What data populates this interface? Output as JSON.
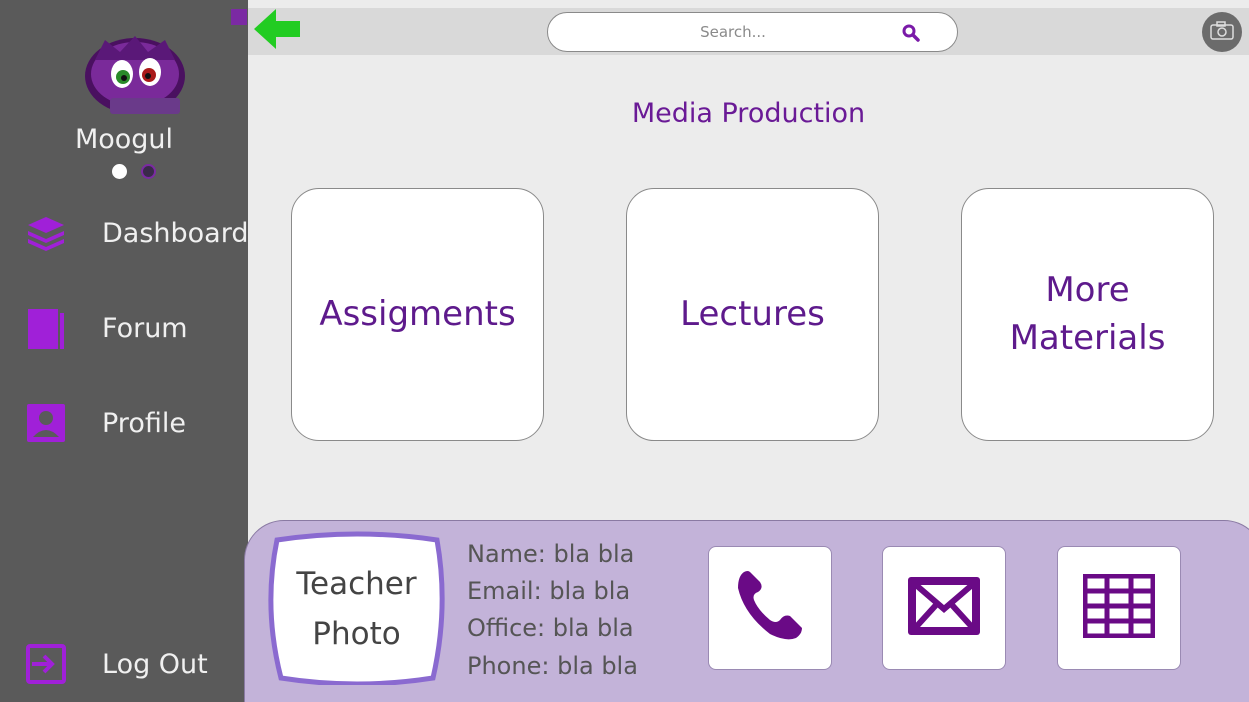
{
  "user": {
    "name": "Moogul"
  },
  "carousel": {
    "dots": 2,
    "active_index": 0
  },
  "nav": {
    "items": [
      {
        "label": "Dashboard",
        "icon": "layers-icon"
      },
      {
        "label": "Forum",
        "icon": "book-icon"
      },
      {
        "label": "Profile",
        "icon": "profile-icon"
      }
    ],
    "logout_label": "Log Out"
  },
  "search": {
    "placeholder": "Search...",
    "value": ""
  },
  "course": {
    "title": "Media Production"
  },
  "cards": [
    {
      "label": "Assigments"
    },
    {
      "label": "Lectures"
    },
    {
      "label": "More\nMaterials"
    }
  ],
  "teacher": {
    "photo_label": "Teacher\nPhoto",
    "fields": [
      {
        "key": "Name:",
        "value": "bla bla"
      },
      {
        "key": "Email:",
        "value": "bla bla"
      },
      {
        "key": "Office:",
        "value": "bla bla"
      },
      {
        "key": "Phone:",
        "value": "bla bla"
      }
    ]
  },
  "actions": [
    {
      "icon": "phone-icon"
    },
    {
      "icon": "mail-icon"
    },
    {
      "icon": "calendar-grid-icon"
    }
  ],
  "colors": {
    "accent": "#6a1a96",
    "accent_icon": "#a020d8",
    "sidebar": "#5a5a5a",
    "panel": "#c3b3d9",
    "back_arrow": "#22cc22"
  }
}
